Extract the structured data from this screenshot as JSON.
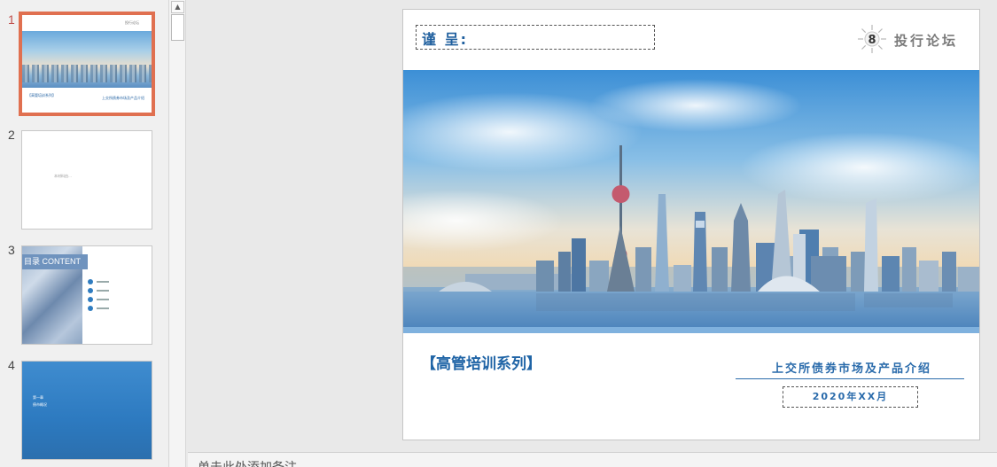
{
  "thumbnails": [
    {
      "number": "1",
      "title": "【高管培训系列】",
      "subtitle": "上交所债券市场及产品介绍",
      "logo_text": "投行论坛"
    },
    {
      "number": "2",
      "text": "本材料由…"
    },
    {
      "number": "3",
      "title": "目录 CONTENT",
      "items": [
        "· · ·",
        "· · ·",
        "· · ·",
        "· · ·"
      ]
    },
    {
      "number": "4",
      "line1": "第一章",
      "line2": "债市概况"
    }
  ],
  "slide": {
    "greeting": "谨 呈:",
    "logo_text": "投行论坛",
    "logo_number": "8",
    "series_title": "【高管培训系列】",
    "subtitle": "上交所债券市场及产品介绍",
    "date": "2020年XX月"
  },
  "notes": {
    "placeholder": "单击此处添加备注"
  },
  "colors": {
    "accent": "#1f64a6",
    "selection": "#e07050"
  }
}
